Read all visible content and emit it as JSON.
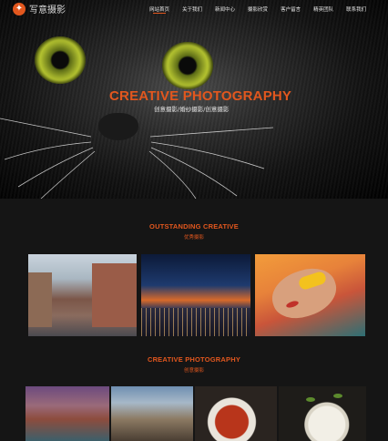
{
  "brand": {
    "name": "写意摄影",
    "logo_glyph": "✦",
    "accent": "#e2571e"
  },
  "nav": {
    "items": [
      {
        "label": "网站首页",
        "active": true
      },
      {
        "label": "关于我们",
        "active": false
      },
      {
        "label": "新闻中心",
        "active": false
      },
      {
        "label": "摄影欣赏",
        "active": false
      },
      {
        "label": "客户留言",
        "active": false
      },
      {
        "label": "精英团队",
        "active": false
      },
      {
        "label": "联系我们",
        "active": false
      }
    ]
  },
  "hero": {
    "title_en": "CREATIVE PHOTOGRAPHY",
    "title_cn": "创意摄影/婚纱摄影/创意摄影"
  },
  "section1": {
    "title_en": "OUTSTANDING CREATIVE",
    "title_cn": "优秀摄影"
  },
  "section2": {
    "title_en": "CREATIVE PHOTOGRAPHY",
    "title_cn": "创意摄影"
  }
}
